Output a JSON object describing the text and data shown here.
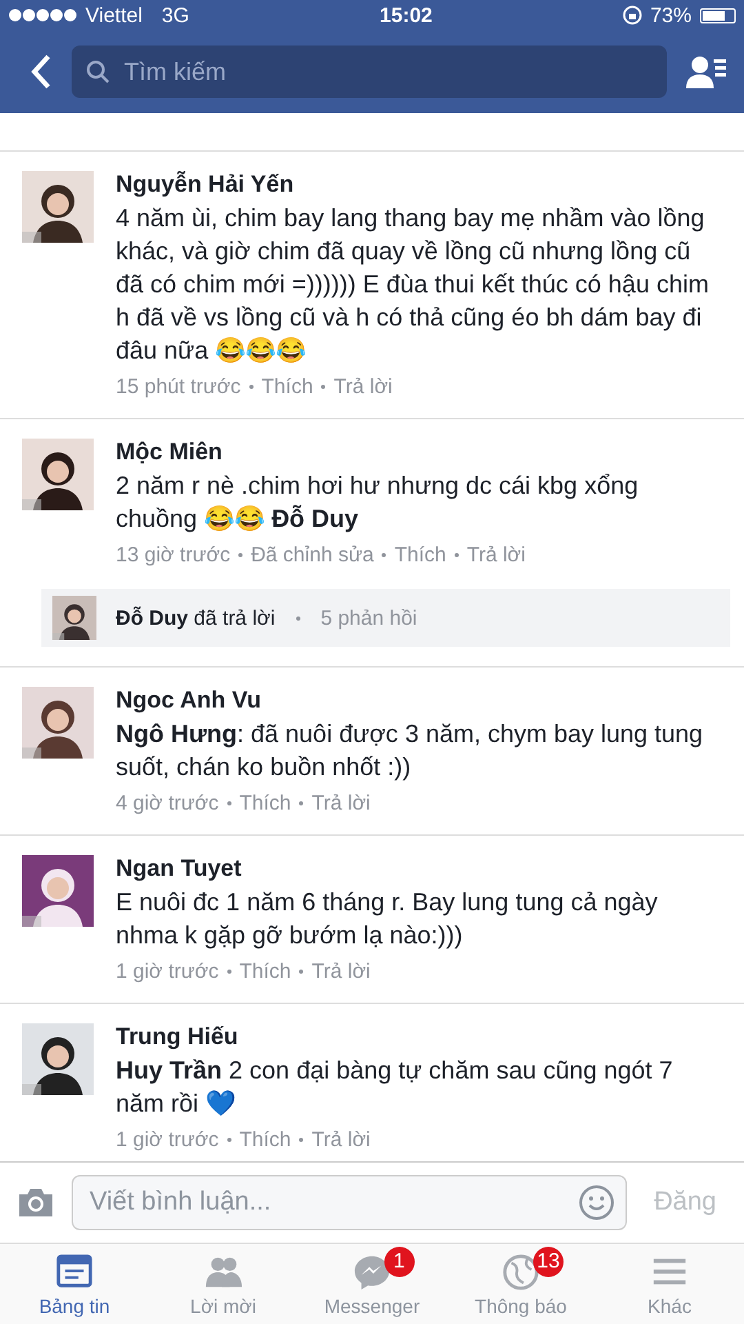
{
  "status_bar": {
    "carrier": "Viettel",
    "network": "3G",
    "time": "15:02",
    "battery": "73%"
  },
  "nav": {
    "search": {
      "placeholder": "Tìm kiếm"
    }
  },
  "comments": [
    {
      "name": "Nguyễn Hải Yến",
      "text": "4 năm ùi, chim bay lang thang bay mẹ nhầm vào lồng khác, và giờ chim đã quay về lồng cũ nhưng lồng cũ đã có chim mới =)))))) E đùa thui kết thúc có hậu chim h đã về vs lồng cũ và h có thả cũng éo bh dám bay đi đâu nữa 😂😂😂",
      "time": "15 phút trước",
      "like": "Thích",
      "reply": "Trả lời"
    },
    {
      "name": "Mộc Miên",
      "text": "2 năm r nè .chim hơi hư nhưng dc cái kbg xổng chuồng 😂😂 **Đỗ Duy**",
      "time": "13 giờ trước",
      "edited": "Đã chỉnh sửa",
      "like": "Thích",
      "reply": "Trả lời",
      "replies": {
        "name": "Đỗ Duy",
        "action": "đã trả lời",
        "count": "5 phản hồi"
      }
    },
    {
      "name": "Ngoc Anh Vu",
      "text": "**Ngô Hưng**: đã nuôi được 3 năm, chym bay lung tung suốt, chán ko buồn nhốt :))",
      "time": "4 giờ trước",
      "like": "Thích",
      "reply": "Trả lời"
    },
    {
      "name": "Ngan Tuyet",
      "text": "E nuôi đc 1 năm 6 tháng r. Bay lung tung cả ngày nhma k gặp gỡ bướm lạ nào:)))",
      "time": "1 giờ trước",
      "like": "Thích",
      "reply": "Trả lời"
    },
    {
      "name": "Trung Hiếu",
      "text": "**Huy Trần** 2 con đại bàng tự chăm sau cũng ngót 7 năm rồi 💙",
      "time": "1 giờ trước",
      "like": "Thích",
      "reply": "Trả lời"
    }
  ],
  "composer": {
    "placeholder": "Viết bình luận...",
    "post": "Đăng"
  },
  "tabs": [
    {
      "label": "Bảng tin",
      "kind": "feed",
      "selected": true
    },
    {
      "label": "Lời mời",
      "kind": "friends",
      "selected": false
    },
    {
      "label": "Messenger",
      "kind": "messenger",
      "selected": false,
      "badge": "1"
    },
    {
      "label": "Thông báo",
      "kind": "globe",
      "selected": false,
      "badge": "13"
    },
    {
      "label": "Khác",
      "kind": "more",
      "selected": false
    }
  ]
}
